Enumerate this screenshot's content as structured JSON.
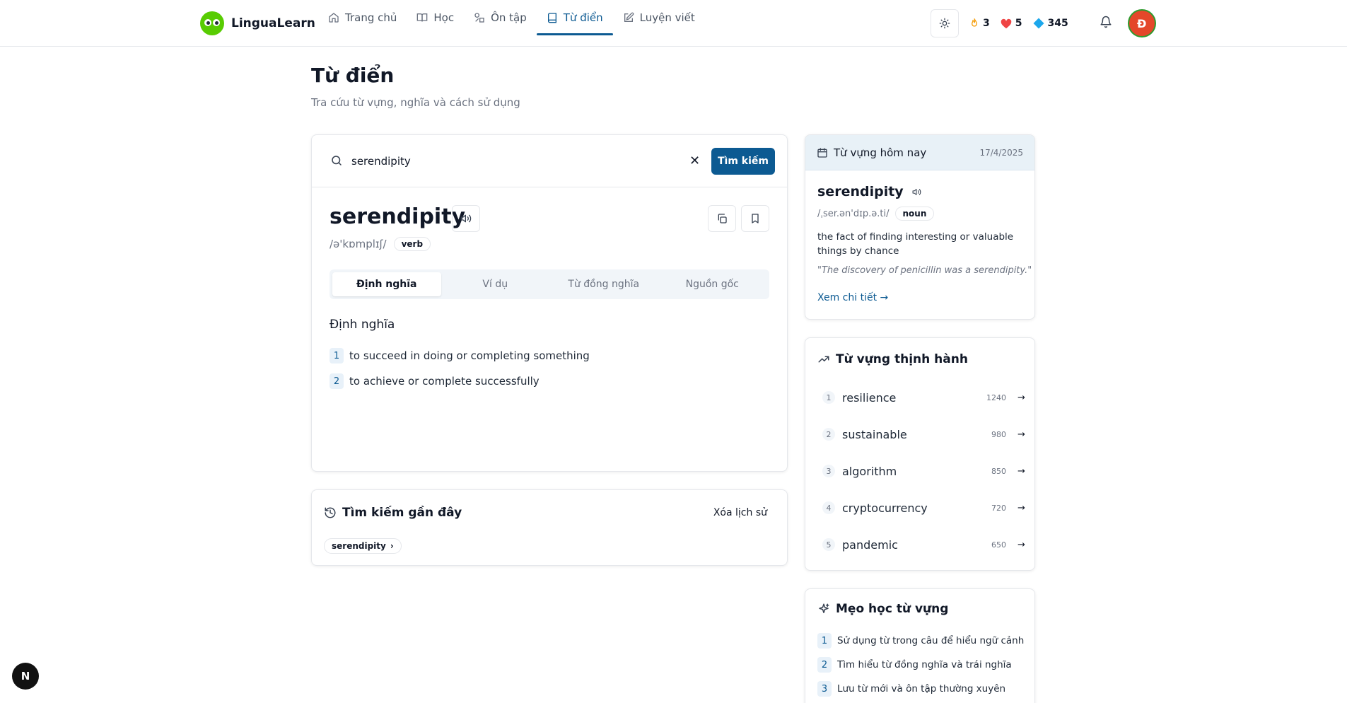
{
  "app": {
    "name": "LinguaLearn"
  },
  "nav": {
    "items": [
      {
        "label": "Trang chủ",
        "icon": "home-icon",
        "active": false
      },
      {
        "label": "Học",
        "icon": "book-open-icon",
        "active": false
      },
      {
        "label": "Ôn tập",
        "icon": "shapes-icon",
        "active": false
      },
      {
        "label": "Từ điển",
        "icon": "book-icon",
        "active": true
      },
      {
        "label": "Luyện viết",
        "icon": "pencil-icon",
        "active": false
      }
    ]
  },
  "header": {
    "streak": "3",
    "hearts": "5",
    "gems": "345",
    "avatar_initial": "Đ",
    "colors": {
      "accent": "#0c5a92",
      "avatar": "#e4472a",
      "logo": "#58cc02"
    }
  },
  "page": {
    "title": "Từ điển",
    "subtitle": "Tra cứu từ vựng, nghĩa và cách sử dụng"
  },
  "search": {
    "value": "serendipity",
    "button_label": "Tìm kiếm",
    "clear_symbol": "✕"
  },
  "entry": {
    "word": "serendipity",
    "phonetic": "/ə'kɒmplɪʃ/",
    "part_of_speech": "verb",
    "tabs": [
      "Định nghĩa",
      "Ví dụ",
      "Từ đồng nghĩa",
      "Nguồn gốc"
    ],
    "active_tab": 0,
    "section_heading": "Định nghĩa",
    "definitions": [
      {
        "num": "1",
        "text": "to succeed in doing or completing something"
      },
      {
        "num": "2",
        "text": "to achieve or complete successfully"
      }
    ]
  },
  "recent": {
    "title": "Tìm kiếm gần đây",
    "clear_label": "Xóa lịch sử",
    "items": [
      "serendipity"
    ]
  },
  "word_of_day": {
    "title": "Từ vựng hôm nay",
    "date": "17/4/2025",
    "word": "serendipity",
    "phonetic": "/ˌser.ən'dɪp.ə.ti/",
    "part_of_speech": "noun",
    "definition": "the fact of finding interesting or valuable things by chance",
    "example": "\"The discovery of penicillin was a serendipity.\"",
    "link_label": "Xem chi tiết →"
  },
  "trending": {
    "title": "Từ vựng thịnh hành",
    "items": [
      {
        "rank": "1",
        "word": "resilience",
        "count": "1240"
      },
      {
        "rank": "2",
        "word": "sustainable",
        "count": "980"
      },
      {
        "rank": "3",
        "word": "algorithm",
        "count": "850"
      },
      {
        "rank": "4",
        "word": "cryptocurrency",
        "count": "720"
      },
      {
        "rank": "5",
        "word": "pandemic",
        "count": "650"
      }
    ]
  },
  "tips": {
    "title": "Mẹo học từ vựng",
    "items": [
      {
        "num": "1",
        "text": "Sử dụng từ trong câu để hiểu ngữ cảnh"
      },
      {
        "num": "2",
        "text": "Tìm hiểu từ đồng nghĩa và trái nghĩa"
      },
      {
        "num": "3",
        "text": "Lưu từ mới và ôn tập thường xuyên"
      }
    ]
  },
  "dev_badge": "N"
}
